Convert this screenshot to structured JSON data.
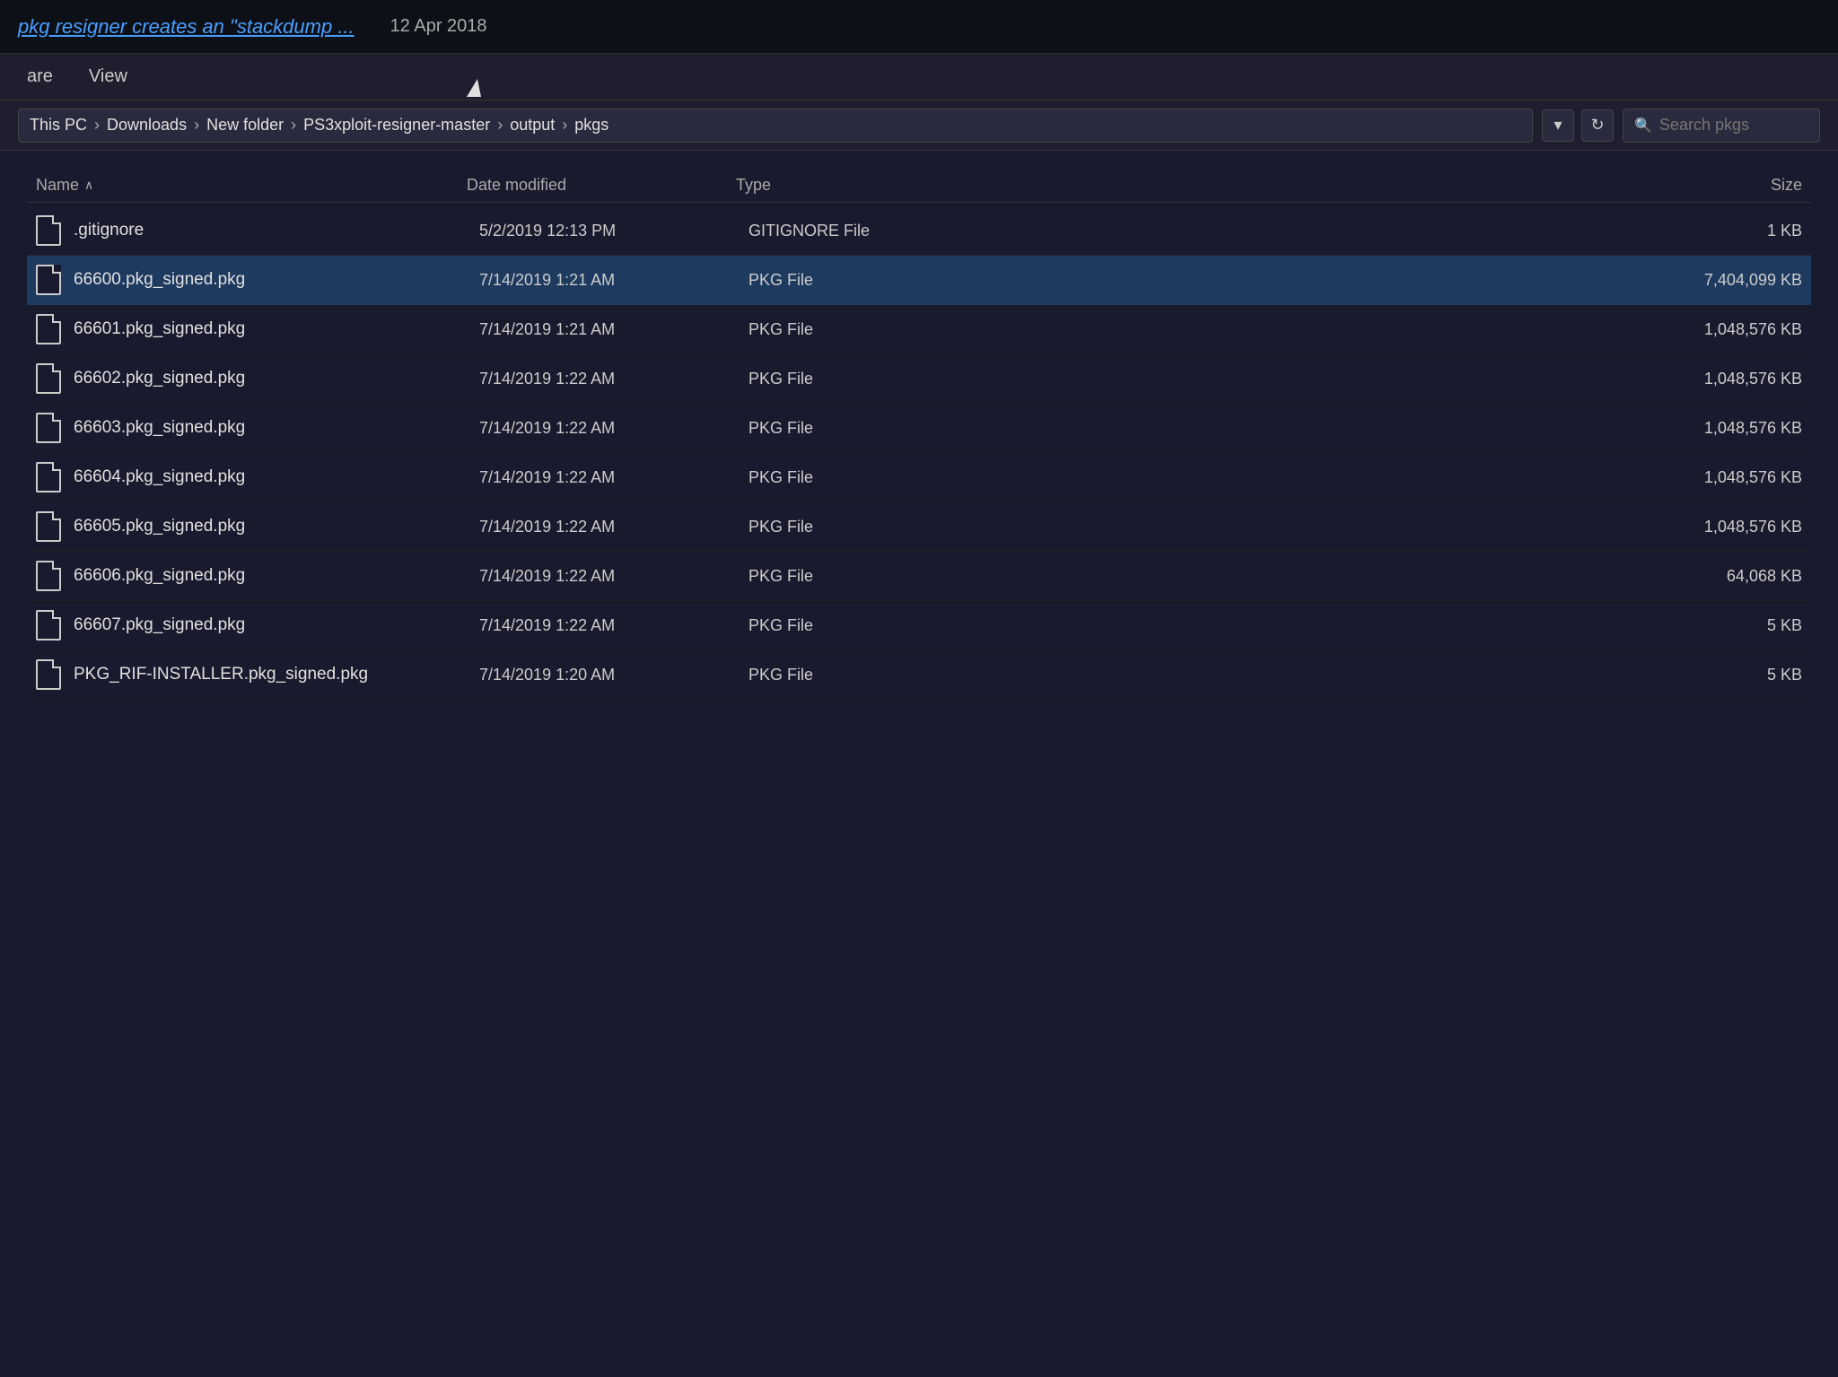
{
  "topbar": {
    "link_text": "pkg resigner creates an \"stackdump ...",
    "date": "12 Apr 2018"
  },
  "menubar": {
    "items": [
      "are",
      "View"
    ]
  },
  "addressbar": {
    "breadcrumb": [
      {
        "label": "This PC"
      },
      {
        "label": "Downloads"
      },
      {
        "label": "New folder"
      },
      {
        "label": "PS3xploit-resigner-master"
      },
      {
        "label": "output"
      },
      {
        "label": "pkgs"
      }
    ],
    "search_placeholder": "Search pkgs",
    "dropdown_icon": "▾",
    "refresh_icon": "↻"
  },
  "columns": {
    "name": "Name",
    "date_modified": "Date modified",
    "type": "Type",
    "size": "Size"
  },
  "files": [
    {
      "name": ".gitignore",
      "date": "5/2/2019 12:13 PM",
      "type": "GITIGNORE File",
      "size": "1 KB",
      "selected": false
    },
    {
      "name": "66600.pkg_signed.pkg",
      "date": "7/14/2019 1:21 AM",
      "type": "PKG File",
      "size": "7,404,099 KB",
      "selected": true
    },
    {
      "name": "66601.pkg_signed.pkg",
      "date": "7/14/2019 1:21 AM",
      "type": "PKG File",
      "size": "1,048,576 KB",
      "selected": false
    },
    {
      "name": "66602.pkg_signed.pkg",
      "date": "7/14/2019 1:22 AM",
      "type": "PKG File",
      "size": "1,048,576 KB",
      "selected": false
    },
    {
      "name": "66603.pkg_signed.pkg",
      "date": "7/14/2019 1:22 AM",
      "type": "PKG File",
      "size": "1,048,576 KB",
      "selected": false
    },
    {
      "name": "66604.pkg_signed.pkg",
      "date": "7/14/2019 1:22 AM",
      "type": "PKG File",
      "size": "1,048,576 KB",
      "selected": false
    },
    {
      "name": "66605.pkg_signed.pkg",
      "date": "7/14/2019 1:22 AM",
      "type": "PKG File",
      "size": "1,048,576 KB",
      "selected": false
    },
    {
      "name": "66606.pkg_signed.pkg",
      "date": "7/14/2019 1:22 AM",
      "type": "PKG File",
      "size": "64,068 KB",
      "selected": false
    },
    {
      "name": "66607.pkg_signed.pkg",
      "date": "7/14/2019 1:22 AM",
      "type": "PKG File",
      "size": "5 KB",
      "selected": false
    },
    {
      "name": "PKG_RIF-INSTALLER.pkg_signed.pkg",
      "date": "7/14/2019 1:20 AM",
      "type": "PKG File",
      "size": "5 KB",
      "selected": false
    }
  ]
}
